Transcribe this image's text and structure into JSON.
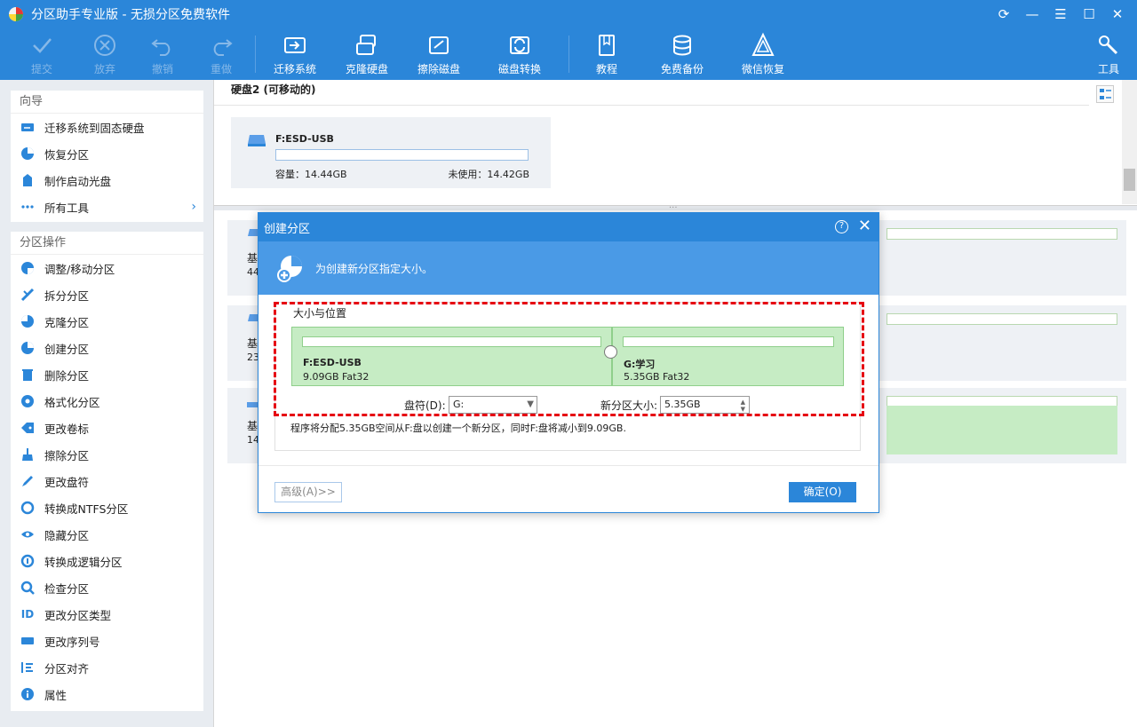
{
  "app": {
    "title": "分区助手专业版 - 无损分区免费软件",
    "win_ctrls": [
      "⟳",
      "—",
      "☰",
      "☐",
      "✕"
    ]
  },
  "toolbar": {
    "items": [
      {
        "label": "提交",
        "icon": "check-icon",
        "enabled": false
      },
      {
        "label": "放弃",
        "icon": "cancel-icon",
        "enabled": false
      },
      {
        "label": "撤销",
        "icon": "undo-icon",
        "enabled": false
      },
      {
        "label": "重做",
        "icon": "redo-icon",
        "enabled": false
      },
      {
        "label": "迁移系统",
        "icon": "migrate-os-icon",
        "enabled": true
      },
      {
        "label": "克隆硬盘",
        "icon": "clone-disk-icon",
        "enabled": true
      },
      {
        "label": "擦除磁盘",
        "icon": "wipe-disk-icon",
        "enabled": true
      },
      {
        "label": "磁盘转换",
        "icon": "convert-disk-icon",
        "enabled": true
      },
      {
        "label": "教程",
        "icon": "tutorial-icon",
        "enabled": true
      },
      {
        "label": "免费备份",
        "icon": "backup-icon",
        "enabled": true
      },
      {
        "label": "微信恢复",
        "icon": "wechat-restore-icon",
        "enabled": true
      },
      {
        "label": "工具",
        "icon": "tools-icon",
        "enabled": true
      }
    ]
  },
  "sidebar": {
    "wizard_title": "向导",
    "wizard_items": [
      {
        "label": "迁移系统到固态硬盘",
        "icon": "migrate-ssd-icon"
      },
      {
        "label": "恢复分区",
        "icon": "recover-partition-icon"
      },
      {
        "label": "制作启动光盘",
        "icon": "bootable-media-icon"
      },
      {
        "label": "所有工具",
        "icon": "more-tools-icon",
        "arrow": "›"
      }
    ],
    "ops_title": "分区操作",
    "ops_items": [
      {
        "label": "调整/移动分区",
        "icon": "resize-partition-icon"
      },
      {
        "label": "拆分分区",
        "icon": "split-partition-icon"
      },
      {
        "label": "克隆分区",
        "icon": "clone-partition-icon"
      },
      {
        "label": "创建分区",
        "icon": "create-partition-icon"
      },
      {
        "label": "删除分区",
        "icon": "delete-partition-icon"
      },
      {
        "label": "格式化分区",
        "icon": "format-partition-icon"
      },
      {
        "label": "更改卷标",
        "icon": "change-label-icon"
      },
      {
        "label": "擦除分区",
        "icon": "wipe-partition-icon"
      },
      {
        "label": "更改盘符",
        "icon": "change-drive-letter-icon"
      },
      {
        "label": "转换成NTFS分区",
        "icon": "convert-ntfs-icon"
      },
      {
        "label": "隐藏分区",
        "icon": "hide-partition-icon"
      },
      {
        "label": "转换成逻辑分区",
        "icon": "convert-logical-icon"
      },
      {
        "label": "检查分区",
        "icon": "check-partition-icon"
      },
      {
        "label": "更改分区类型",
        "icon": "change-type-icon"
      },
      {
        "label": "更改序列号",
        "icon": "change-serial-icon"
      },
      {
        "label": "分区对齐",
        "icon": "align-partition-icon"
      },
      {
        "label": "属性",
        "icon": "properties-icon"
      }
    ]
  },
  "main": {
    "disk_header": "硬盘2 (可移动的)",
    "usb_card": {
      "name": "F:ESD-USB",
      "capacity": "容量：14.44GB",
      "free": "未使用：14.42GB"
    },
    "lower_cards": [
      {
        "line1": "基",
        "line2": "44"
      },
      {
        "line1": "基",
        "line2": "23"
      },
      {
        "line1": "基",
        "line2": "14"
      }
    ]
  },
  "dialog": {
    "title": "创建分区",
    "help": "?",
    "close": "✕",
    "banner_text": "为创建新分区指定大小。",
    "group_title": "大小与位置",
    "left_partition": {
      "name": "F:ESD-USB",
      "info": "9.09GB Fat32"
    },
    "right_partition": {
      "name": "G:学习",
      "info": "5.35GB Fat32"
    },
    "drive_letter_label": "盘符(D):",
    "drive_letter_value": "G:",
    "new_size_label": "新分区大小:",
    "new_size_value": "5.35GB",
    "description": "程序将分配5.35GB空间从F:盘以创建一个新分区，同时F:盘将减小到9.09GB.",
    "advanced_button": "高级(A)>>",
    "ok_button": "确定(O)"
  },
  "colors": {
    "accent": "#2b86d9",
    "partition_green": "#c6ecc4",
    "highlight_dashed": "#e60012"
  }
}
